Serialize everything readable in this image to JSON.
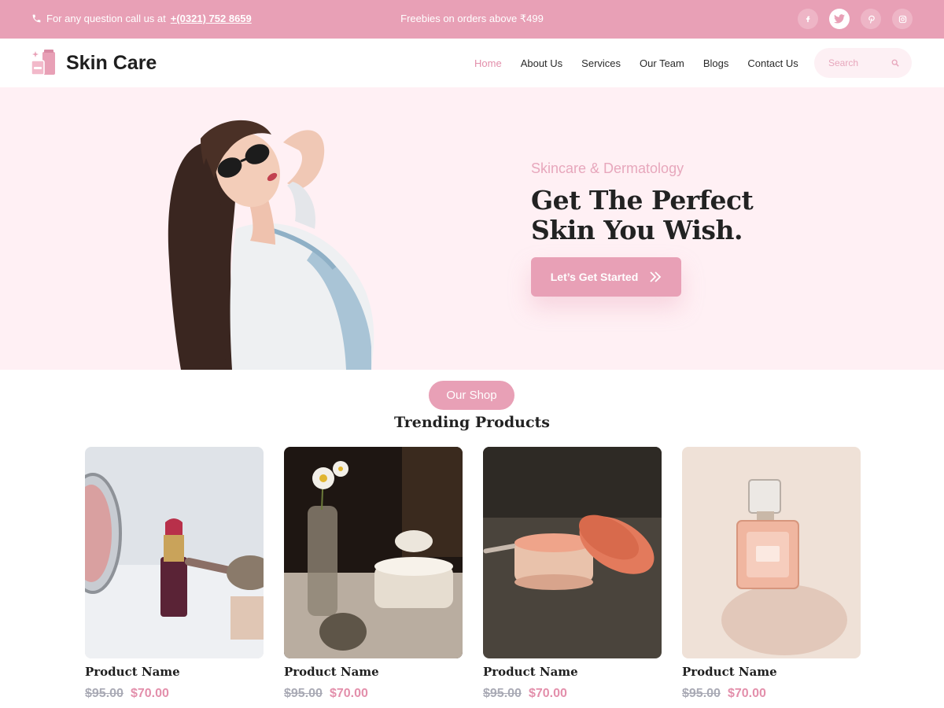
{
  "topbar": {
    "call_text": "For any question call us at",
    "phone": "+(0321) 752 8659",
    "promo": "Freebies on orders above ₹499",
    "social": [
      {
        "icon": "facebook-icon",
        "glyph": "f"
      },
      {
        "icon": "twitter-icon",
        "glyph": "t"
      },
      {
        "icon": "pinterest-icon",
        "glyph": "p"
      },
      {
        "icon": "instagram-icon",
        "glyph": "◎"
      }
    ]
  },
  "header": {
    "brand": "Skin Care",
    "nav": [
      "Home",
      "About Us",
      "Services",
      "Our Team",
      "Blogs",
      "Contact Us"
    ],
    "active_nav": "Home",
    "search_placeholder": "Search"
  },
  "hero": {
    "eyebrow": "Skincare & Dermatology",
    "headline_line1": "Get The Perfect",
    "headline_line2": "Skin You Wish.",
    "cta_label": "Let’s Get Started"
  },
  "shop": {
    "pill": "Our Shop",
    "title": "Trending Products",
    "products": [
      {
        "name": "Product Name",
        "old_price": "$95.00",
        "price": "$70.00",
        "image": "lipstick-mirror-photo"
      },
      {
        "name": "Product Name",
        "old_price": "$95.00",
        "price": "$70.00",
        "image": "cream-jars-flowers-photo"
      },
      {
        "name": "Product Name",
        "old_price": "$95.00",
        "price": "$70.00",
        "image": "blush-jar-photo"
      },
      {
        "name": "Product Name",
        "old_price": "$95.00",
        "price": "$70.00",
        "image": "perfume-bottle-photo"
      }
    ]
  },
  "colors": {
    "accent": "#e8a0b6",
    "accent_text": "#e38fab",
    "hero_bg": "#fff0f4",
    "strike": "#a9aab5"
  }
}
